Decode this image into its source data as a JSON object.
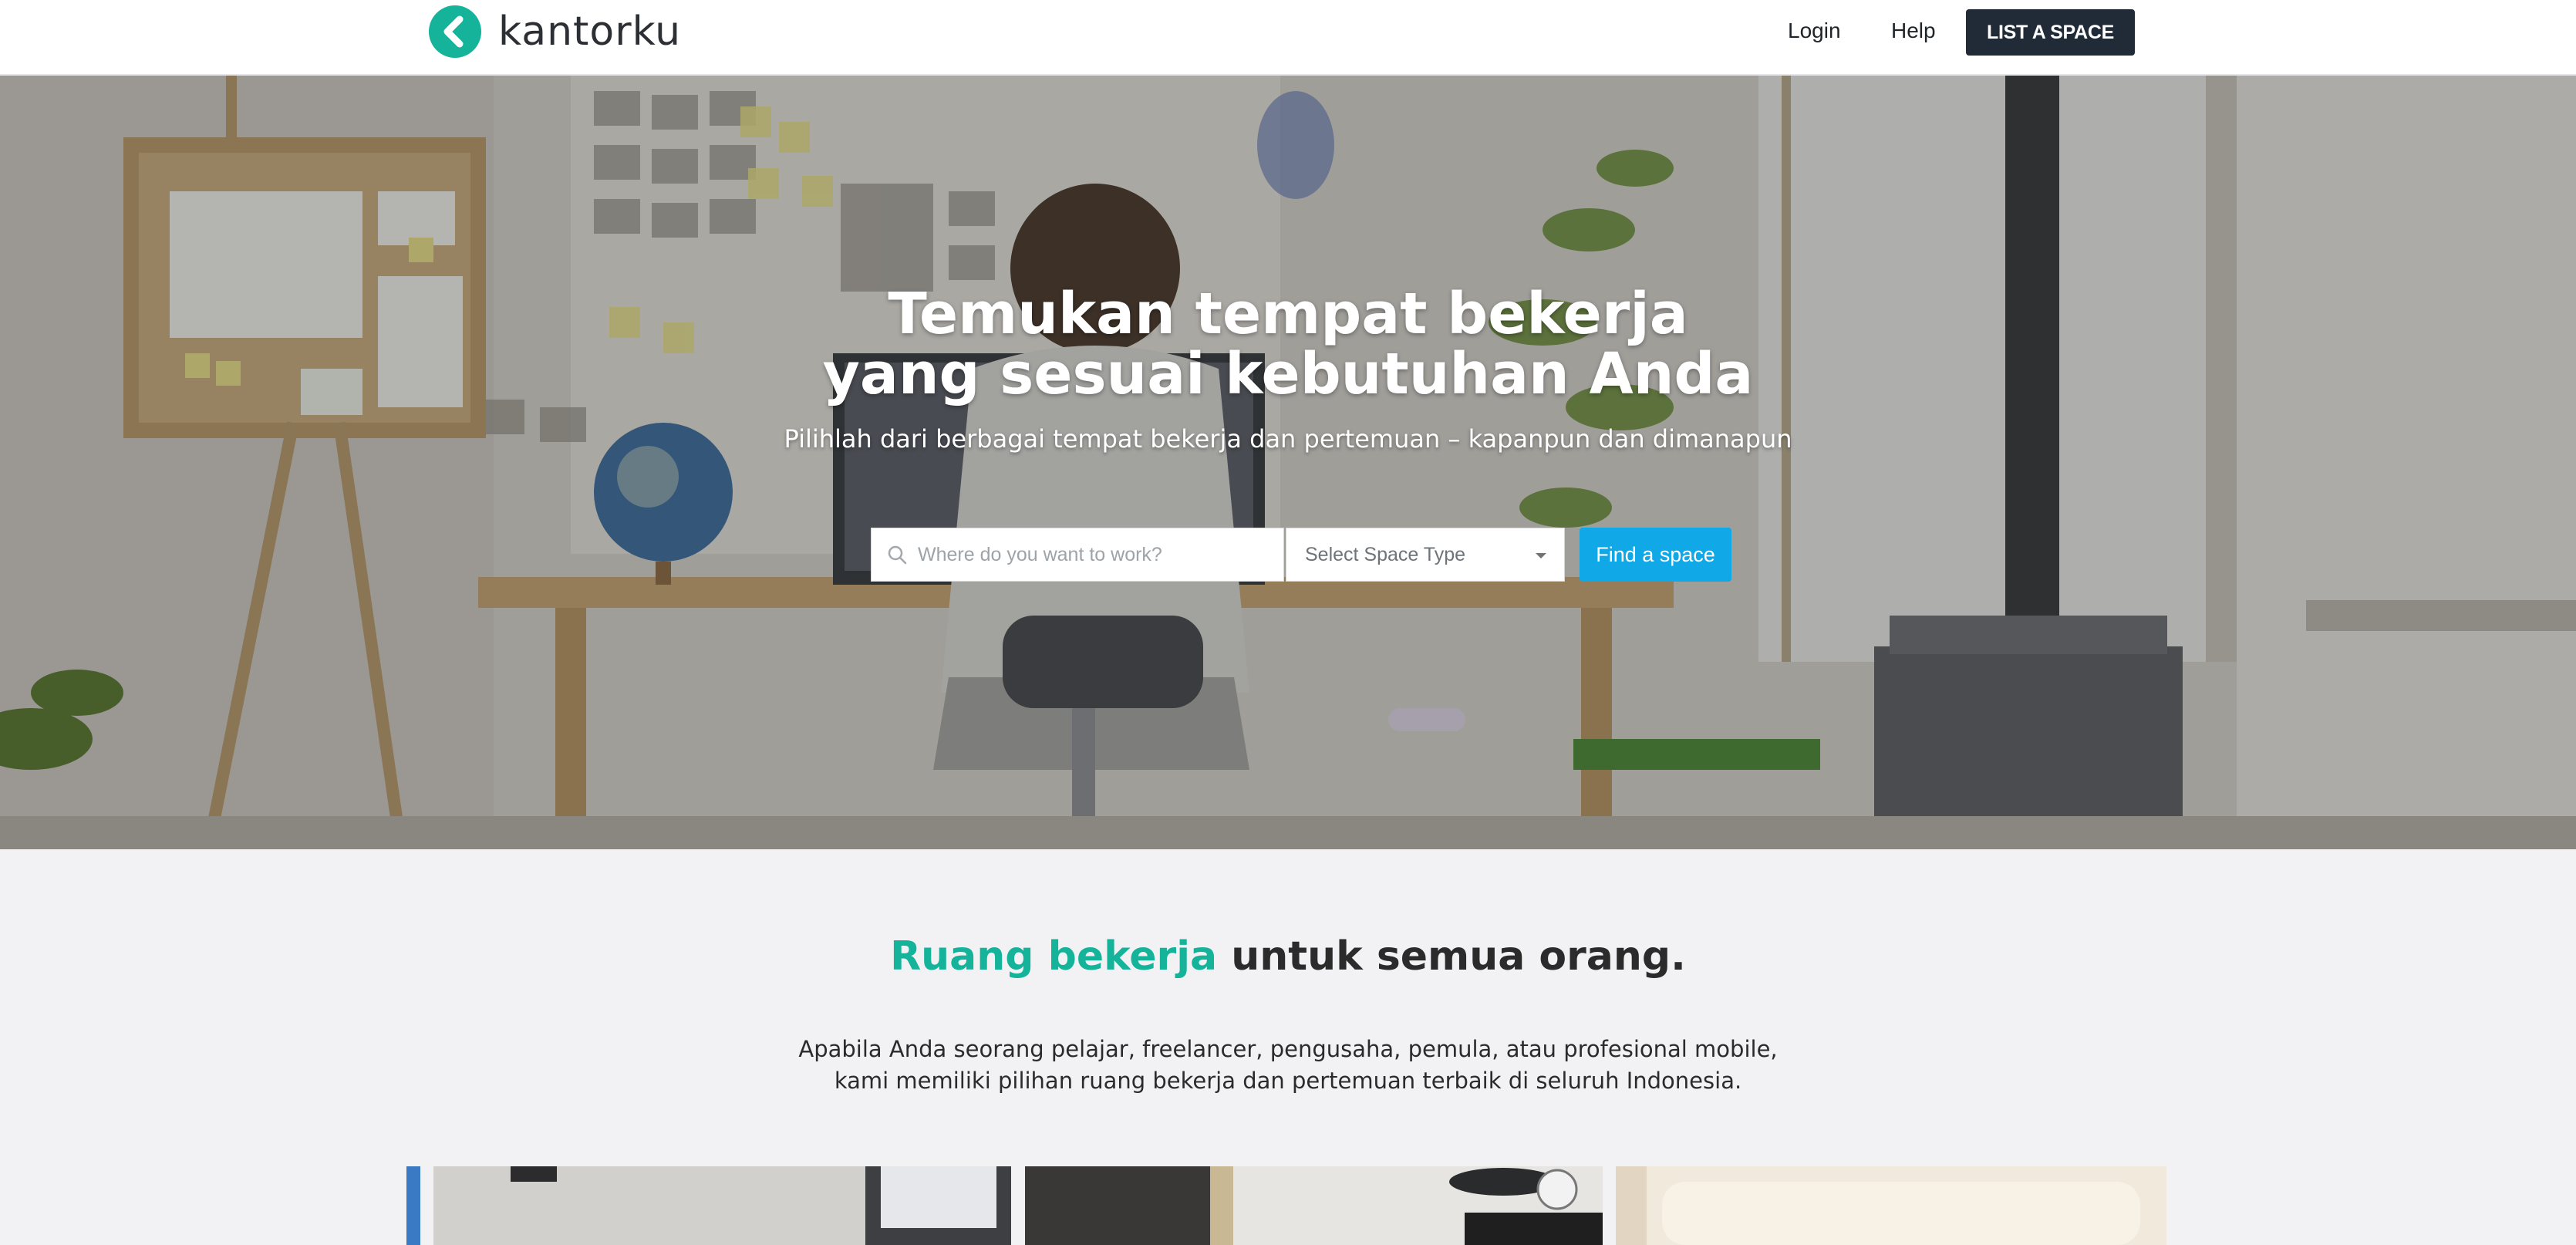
{
  "header": {
    "brand": "kantorku",
    "nav": {
      "login": "Login",
      "help": "Help",
      "list_space": "LIST A SPACE"
    }
  },
  "hero": {
    "title_line1": "Temukan tempat bekerja",
    "title_line2": "yang sesuai kebutuhan Anda",
    "subtitle": "Pilihlah dari berbagai tempat bekerja dan pertemuan – kapanpun dan dimanapun",
    "search": {
      "placeholder": "Where do you want to work?",
      "space_type_value": "Select Space Type",
      "button": "Find a space"
    }
  },
  "intro": {
    "title_accent": "Ruang bekerja",
    "title_rest": " untuk semua orang.",
    "desc_line1": "Apabila Anda seorang pelajar, freelancer, pengusaha, pemula, atau profesional mobile,",
    "desc_line2": "kami memiliki pilihan ruang bekerja dan pertemuan terbaik di seluruh Indonesia."
  },
  "colors": {
    "brand": "#14b39a",
    "dark": "#202b37",
    "cta": "#10a8e6"
  },
  "icons": {
    "logo": "kantorku-k-icon",
    "search": "search-icon",
    "dropdown": "chevron-down-icon"
  }
}
